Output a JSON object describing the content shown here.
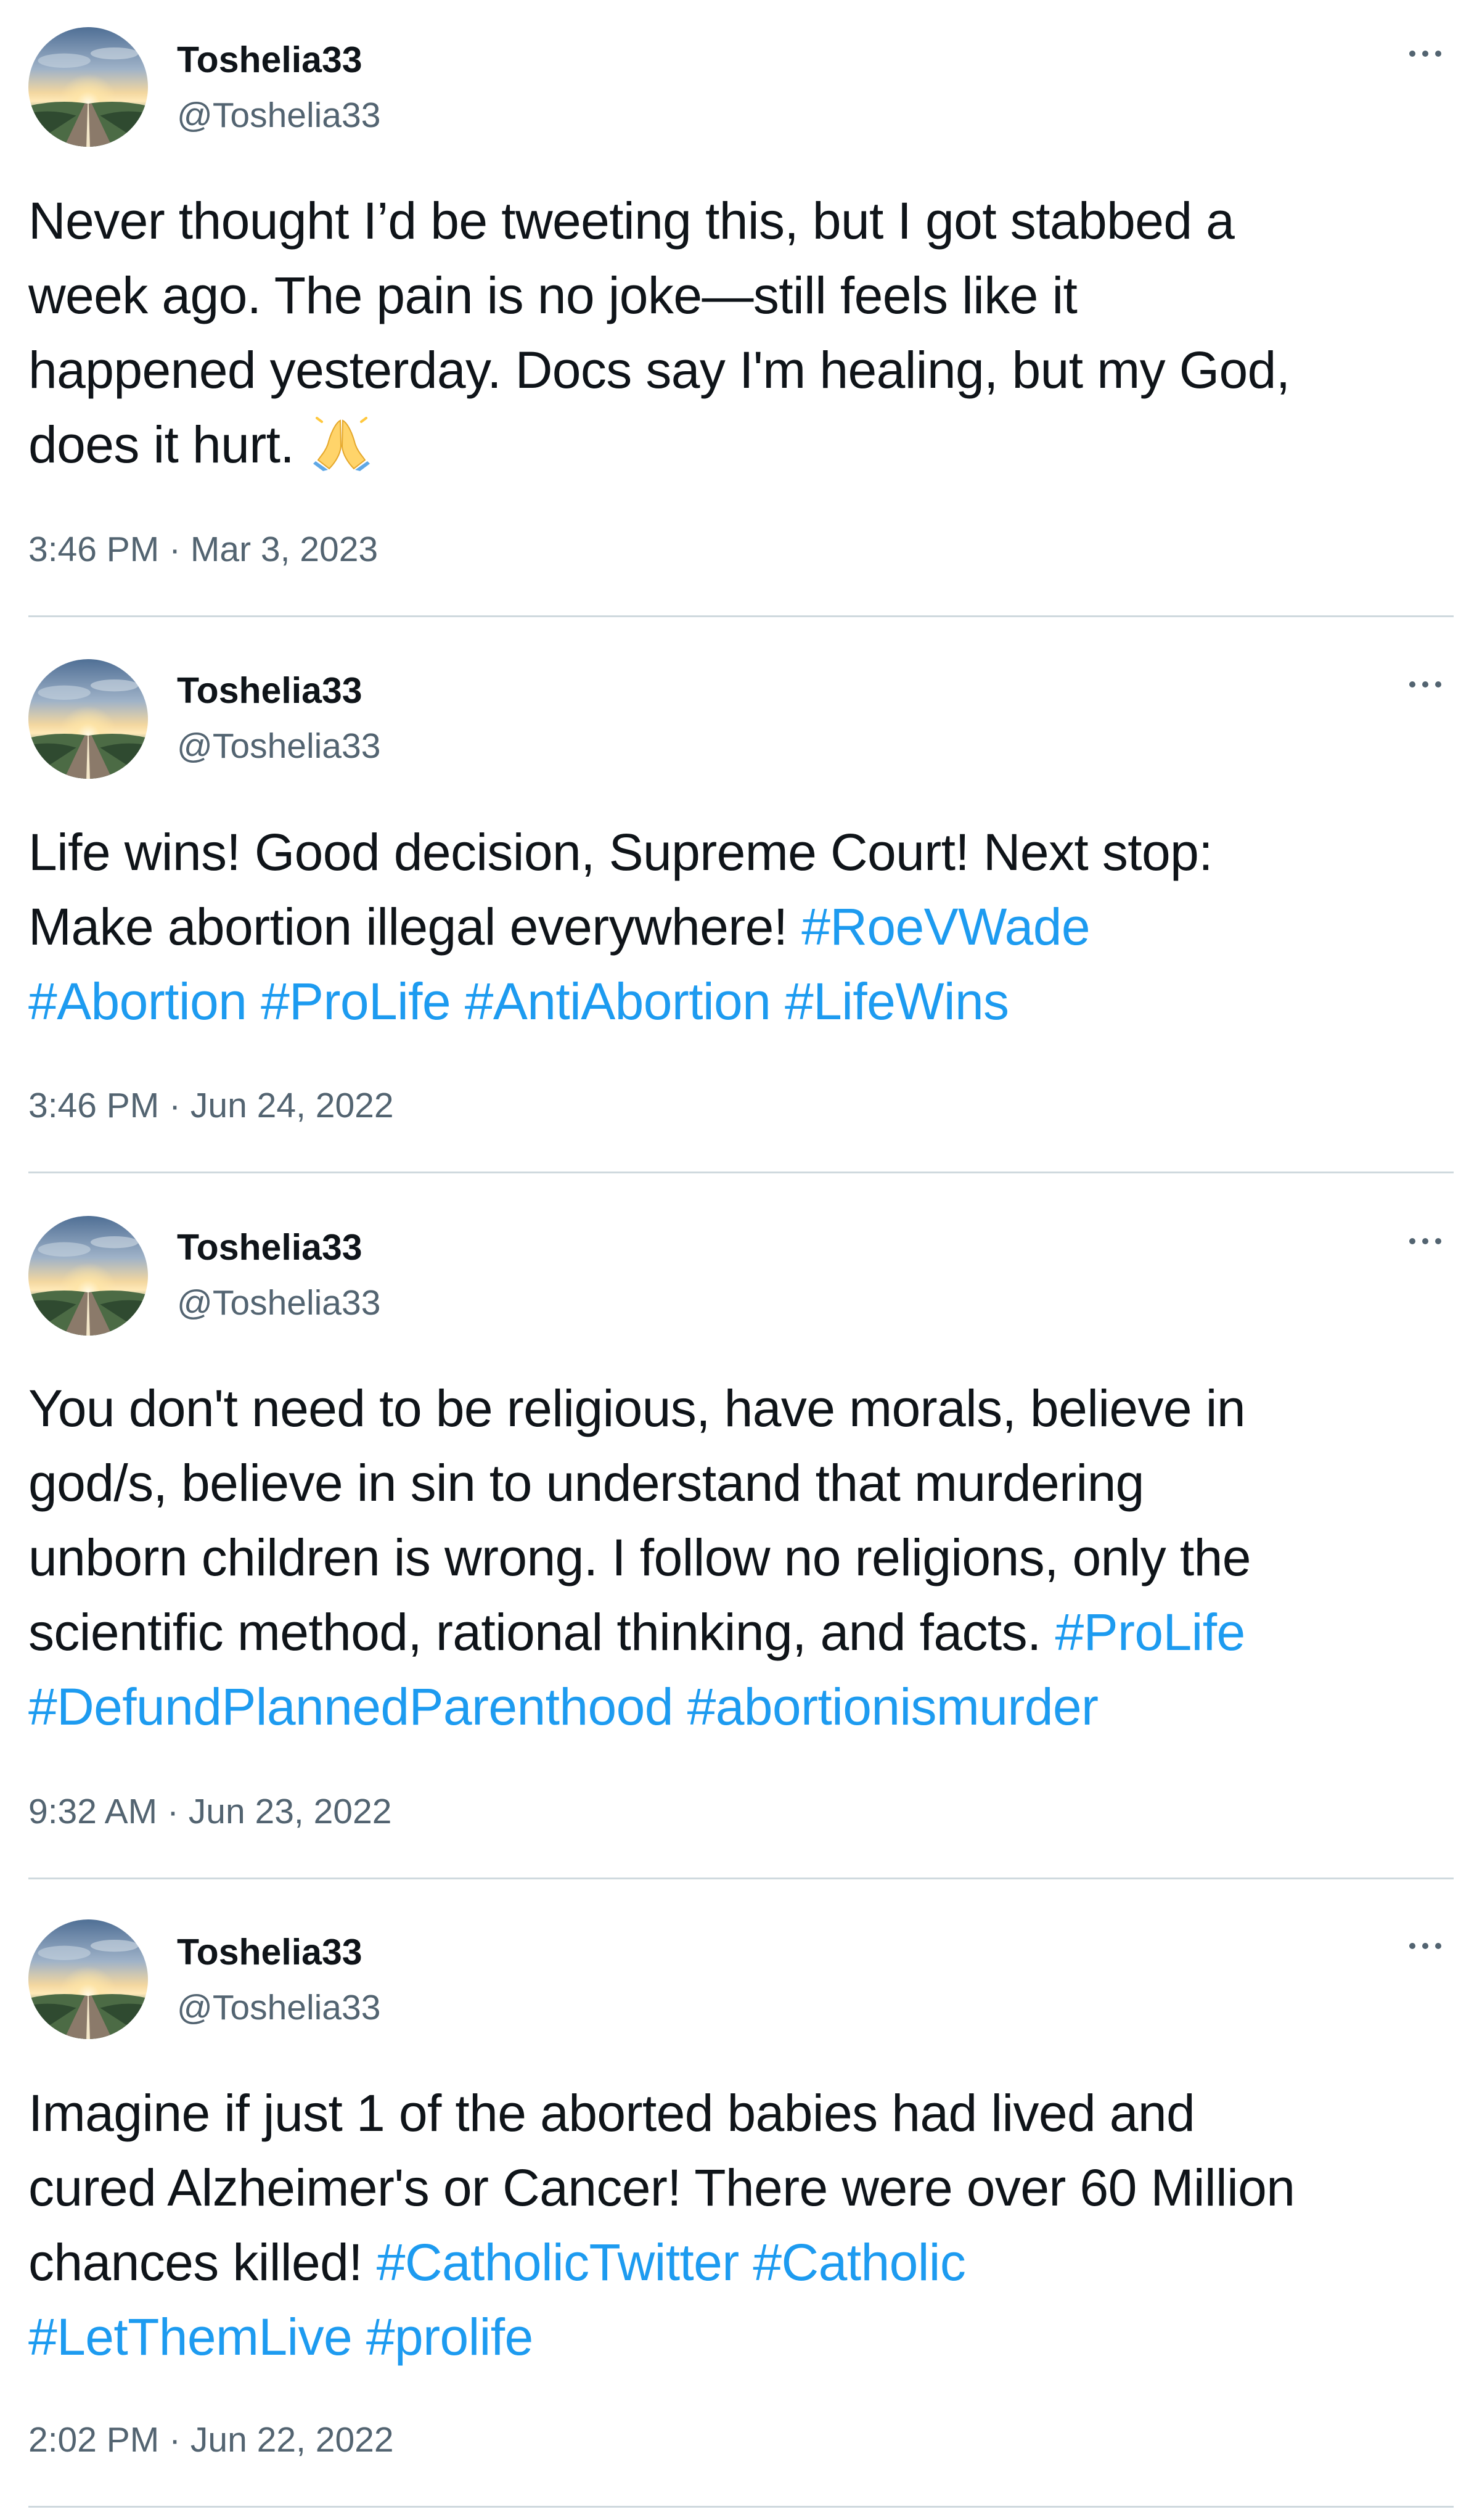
{
  "colors": {
    "text": "#0f1419",
    "secondary": "#536471",
    "hashtag": "#1d9bf0",
    "divider": "#cfd9de"
  },
  "tweets": [
    {
      "name": "Toshelia33",
      "handle": "@Toshelia33",
      "timestamp": "3:46 PM · Mar 3, 2023",
      "emoji": "folded-hands",
      "lines": [
        [
          {
            "t": "Never thought I’d be tweeting this, but I got stabbed a"
          }
        ],
        [
          {
            "t": "week ago. The pain is no joke—still feels like it"
          }
        ],
        [
          {
            "t": "happened yesterday. Docs say I'm healing, but my God,"
          }
        ],
        [
          {
            "t": "does it hurt."
          }
        ]
      ]
    },
    {
      "name": "Toshelia33",
      "handle": "@Toshelia33",
      "timestamp": "3:46 PM · Jun 24, 2022",
      "lines": [
        [
          {
            "t": "Life wins! Good decision, Supreme Court! Next stop:"
          }
        ],
        [
          {
            "t": "Make abortion illegal everywhere! "
          },
          {
            "h": "#RoeVWade"
          }
        ],
        [
          {
            "h": "#Abortion"
          },
          {
            "t": " "
          },
          {
            "h": "#ProLife"
          },
          {
            "t": " "
          },
          {
            "h": "#AntiAbortion"
          },
          {
            "t": " "
          },
          {
            "h": "#LifeWins"
          }
        ]
      ]
    },
    {
      "name": "Toshelia33",
      "handle": "@Toshelia33",
      "timestamp": "9:32 AM · Jun 23, 2022",
      "lines": [
        [
          {
            "t": "You don't need to be religious, have morals, believe in"
          }
        ],
        [
          {
            "t": "god/s, believe in sin to understand that murdering"
          }
        ],
        [
          {
            "t": "unborn children is wrong. I follow no religions, only the"
          }
        ],
        [
          {
            "t": "scientific method, rational thinking, and facts. "
          },
          {
            "h": "#ProLife"
          }
        ],
        [
          {
            "h": "#DefundPlannedParenthood"
          },
          {
            "t": " "
          },
          {
            "h": "#abortionismurder"
          }
        ]
      ]
    },
    {
      "name": "Toshelia33",
      "handle": "@Toshelia33",
      "timestamp": "2:02 PM · Jun 22, 2022",
      "lines": [
        [
          {
            "t": "Imagine if just 1 of the aborted babies had lived and"
          }
        ],
        [
          {
            "t": "cured Alzheimer's or Cancer! There were over 60 Million"
          }
        ],
        [
          {
            "t": "chances killed! "
          },
          {
            "h": "#CatholicTwitter"
          },
          {
            "t": " "
          },
          {
            "h": "#Catholic"
          }
        ],
        [
          {
            "h": "#LetThemLive"
          },
          {
            "t": " "
          },
          {
            "h": "#prolife"
          }
        ]
      ]
    }
  ]
}
